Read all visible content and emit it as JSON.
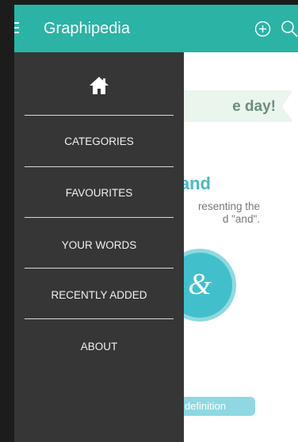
{
  "app": {
    "title": "Graphipedia"
  },
  "toolbar": {
    "add_icon": "plus-circle-icon",
    "search_icon": "search-icon",
    "menu_icon": "hamburger-icon"
  },
  "content": {
    "ribbon_text": "e day!",
    "word_fragment": "and",
    "description_lines": [
      "resenting the",
      "d \"and\"."
    ],
    "symbol": "&",
    "button_label": "definition"
  },
  "drawer": {
    "home_icon": "home-icon",
    "items": [
      {
        "label": "CATEGORIES"
      },
      {
        "label": "FAVOURITES"
      },
      {
        "label": "YOUR WORDS"
      },
      {
        "label": "RECENTLY ADDED"
      },
      {
        "label": "ABOUT"
      }
    ]
  },
  "colors": {
    "primary": "#2bb3a6",
    "drawer": "#363636",
    "accent": "#41c0cc",
    "button": "#8fd8e1"
  }
}
